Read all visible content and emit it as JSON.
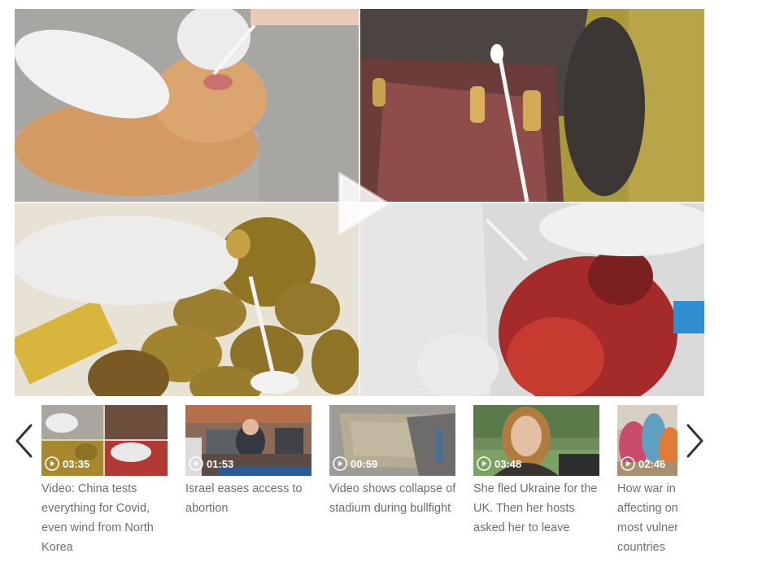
{
  "player": {
    "panels": [
      {
        "subject": "cat mouth swab"
      },
      {
        "subject": "hippo mouth swab"
      },
      {
        "subject": "kiwi fruit swab"
      },
      {
        "subject": "rooster swab"
      }
    ],
    "play_icon": "play-icon"
  },
  "carousel": {
    "prev_icon": "chevron-left-icon",
    "next_icon": "chevron-right-icon",
    "items": [
      {
        "duration": "03:35",
        "title": "Video: China tests everything for Covid, even wind from North Korea"
      },
      {
        "duration": "01:53",
        "title": "Israel eases access to abortion"
      },
      {
        "duration": "00:59",
        "title": "Video shows collapse of stadium during bullfight"
      },
      {
        "duration": "03:48",
        "title": "She fled Ukraine for the UK. Then her hosts asked her to leave"
      },
      {
        "duration": "02:46",
        "title": "How war in Ukraine is affecting one of the most vulnerable African countries"
      }
    ]
  }
}
